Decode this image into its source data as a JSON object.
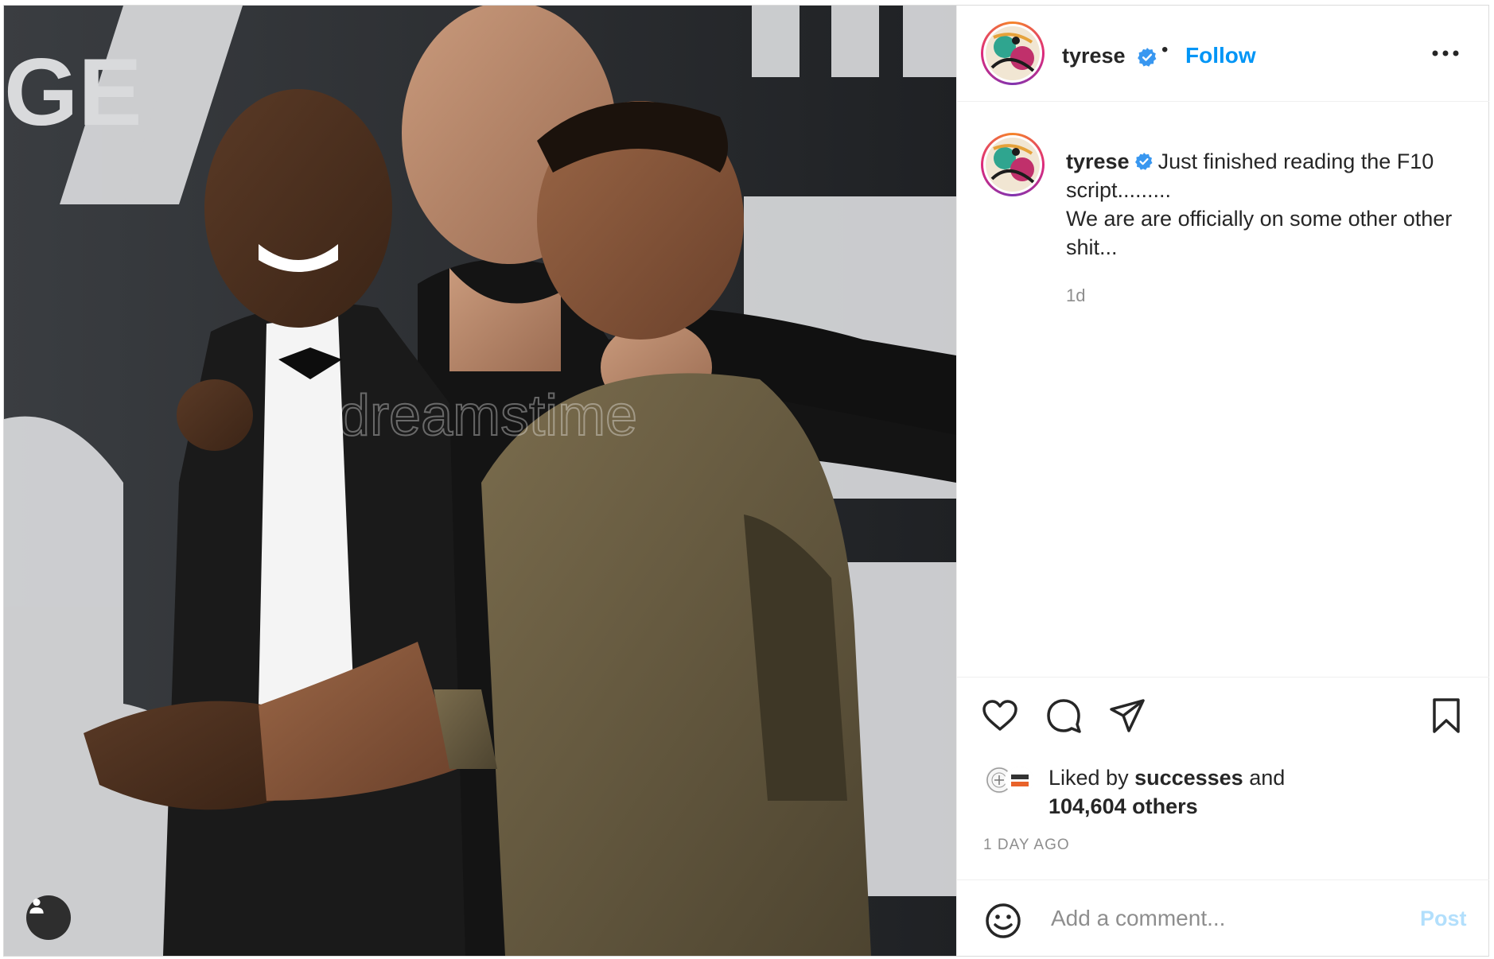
{
  "post": {
    "author": "tyrese",
    "verified": true,
    "follow_label": "Follow",
    "separator": "•",
    "caption": {
      "username": "tyrese",
      "text": "Just finished reading the F10 script.........",
      "text_line2": "We are are officially on some other other shit..."
    },
    "caption_time": "1d",
    "likes": {
      "prefix": "Liked by ",
      "user": "successes",
      "suffix": " and",
      "others": "104,604 others"
    },
    "posted_ago": "1 DAY AGO",
    "media": {
      "watermark": "dreamstime",
      "backdrop_text": "GE"
    }
  },
  "comment_box": {
    "placeholder": "Add a comment...",
    "post_label": "Post"
  },
  "colors": {
    "accent": "#0095f6",
    "post_disabled": "#b2dffc",
    "muted": "#8e8e8e",
    "text": "#262626"
  },
  "icons": [
    "heart-icon",
    "comment-icon",
    "share-icon",
    "bookmark-icon",
    "more-icon",
    "emoji-icon",
    "tagged-user-icon",
    "verified-icon"
  ]
}
